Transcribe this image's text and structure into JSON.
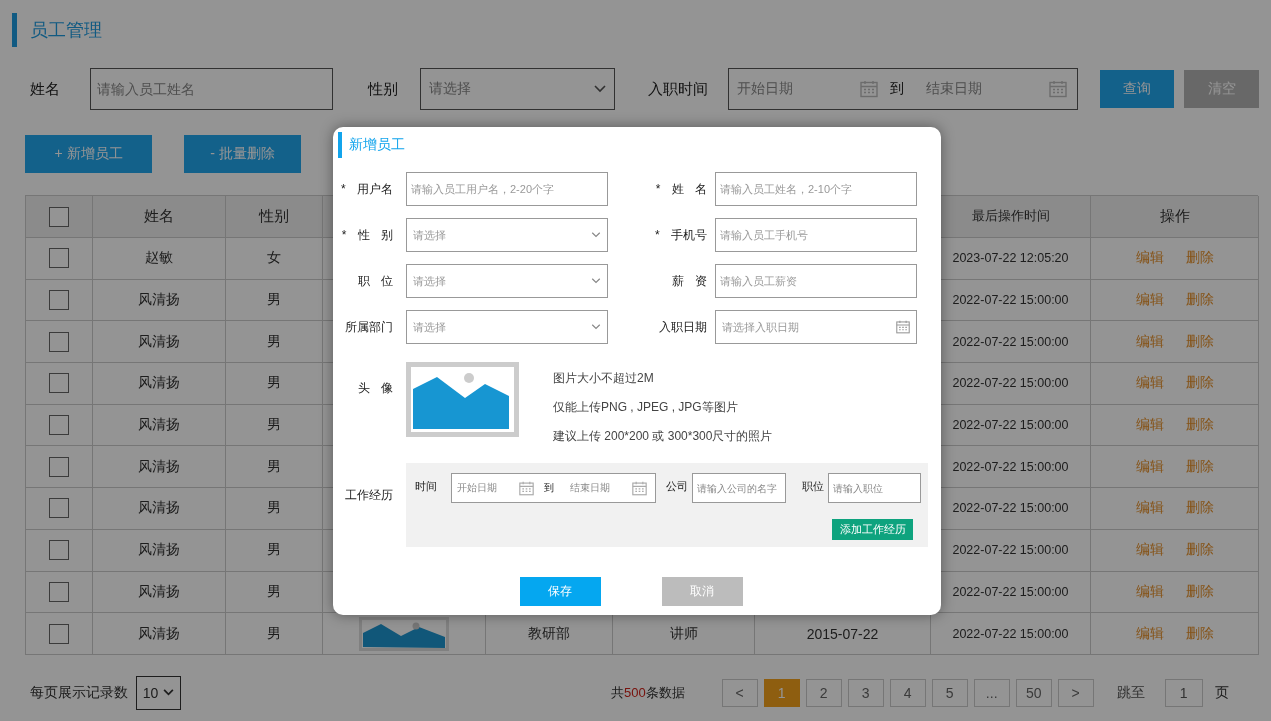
{
  "page_title": "员工管理",
  "filters": {
    "name": {
      "label": "姓名",
      "placeholder": "请输入员工姓名"
    },
    "gender": {
      "label": "性别",
      "placeholder": "请选择"
    },
    "hire_time": {
      "label": "入职时间",
      "start_placeholder": "开始日期",
      "separator": "到",
      "end_placeholder": "结束日期"
    },
    "search_button": "查询",
    "clear_button": "清空"
  },
  "actions": {
    "add_button": "+ 新增员工",
    "batch_delete_button": "- 批量删除"
  },
  "table": {
    "header_checked": false,
    "columns_left": [
      "姓名",
      "性别"
    ],
    "columns_right": [
      "最后操作时间",
      "操作"
    ],
    "rows": [
      {
        "checked": false,
        "name": "赵敏",
        "gender": "女",
        "last_operated": "2023-07-22 12:05:20",
        "edit": "编辑",
        "delete": "删除"
      },
      {
        "checked": false,
        "name": "风清扬",
        "gender": "男",
        "last_operated": "2022-07-22 15:00:00",
        "edit": "编辑",
        "delete": "删除"
      },
      {
        "checked": false,
        "name": "风清扬",
        "gender": "男",
        "last_operated": "2022-07-22 15:00:00",
        "edit": "编辑",
        "delete": "删除"
      },
      {
        "checked": false,
        "name": "风清扬",
        "gender": "男",
        "last_operated": "2022-07-22 15:00:00",
        "edit": "编辑",
        "delete": "删除"
      },
      {
        "checked": false,
        "name": "风清扬",
        "gender": "男",
        "last_operated": "2022-07-22 15:00:00",
        "edit": "编辑",
        "delete": "删除"
      },
      {
        "checked": false,
        "name": "风清扬",
        "gender": "男",
        "last_operated": "2022-07-22 15:00:00",
        "edit": "编辑",
        "delete": "删除"
      },
      {
        "checked": false,
        "name": "风清扬",
        "gender": "男",
        "last_operated": "2022-07-22 15:00:00",
        "edit": "编辑",
        "delete": "删除"
      },
      {
        "checked": false,
        "name": "风清扬",
        "gender": "男",
        "last_operated": "2022-07-22 15:00:00",
        "edit": "编辑",
        "delete": "删除"
      },
      {
        "checked": false,
        "name": "风清扬",
        "gender": "男",
        "last_operated": "2022-07-22 15:00:00",
        "edit": "编辑",
        "delete": "删除"
      },
      {
        "checked": false,
        "name": "风清扬",
        "gender": "男",
        "avatar": true,
        "department": "教研部",
        "position": "讲师",
        "hire_date": "2015-07-22",
        "last_operated": "2022-07-22 15:00:00",
        "edit": "编辑",
        "delete": "删除"
      }
    ]
  },
  "pagination": {
    "page_size_label": "每页展示记录数",
    "page_size": "10",
    "total_prefix": "共",
    "total_count": "500",
    "total_suffix": "条数据",
    "prev": "<",
    "pages": [
      {
        "label": "1",
        "selected": true
      },
      {
        "label": "2",
        "selected": false
      },
      {
        "label": "3",
        "selected": false
      },
      {
        "label": "4",
        "selected": false
      },
      {
        "label": "5",
        "selected": false
      },
      {
        "label": "...",
        "selected": false
      },
      {
        "label": "50",
        "selected": false
      }
    ],
    "next": ">",
    "jump_label": "跳至",
    "jump_value": "1",
    "jump_suffix": "页"
  },
  "dialog": {
    "title": "新增员工",
    "fields": [
      {
        "label": "* 用户名",
        "kind": "input",
        "placeholder": "请输入员工用户名，2-20个字"
      },
      {
        "label": "* 姓 名",
        "kind": "input",
        "placeholder": "请输入员工姓名，2-10个字"
      },
      {
        "label": "* 性 别",
        "kind": "select",
        "placeholder": "请选择"
      },
      {
        "label": "* 手机号",
        "kind": "input",
        "placeholder": "请输入员工手机号"
      },
      {
        "label": "职 位",
        "kind": "select",
        "placeholder": "请选择"
      },
      {
        "label": "薪 资",
        "kind": "input",
        "placeholder": "请输入员工薪资"
      },
      {
        "label": "所属部门",
        "kind": "select",
        "placeholder": "请选择"
      },
      {
        "label": "入职日期",
        "kind": "date",
        "placeholder": "请选择入职日期"
      }
    ],
    "avatar": {
      "label": "头 像",
      "hints": [
        "图片大小不超过2M",
        "仅能上传PNG , JPEG , JPG等图片",
        "建议上传 200*200 或 300*300尺寸的照片"
      ]
    },
    "experience": {
      "label": "工作经历",
      "time_label": "时间",
      "start_placeholder": "开始日期",
      "separator": "到",
      "end_placeholder": "结束日期",
      "company_label": "公司",
      "company_placeholder": "请输入公司的名字",
      "position_label": "职位",
      "position_placeholder": "请输入职位",
      "add_button": "添加工作经历"
    },
    "save_button": "保存",
    "cancel_button": "取消"
  }
}
